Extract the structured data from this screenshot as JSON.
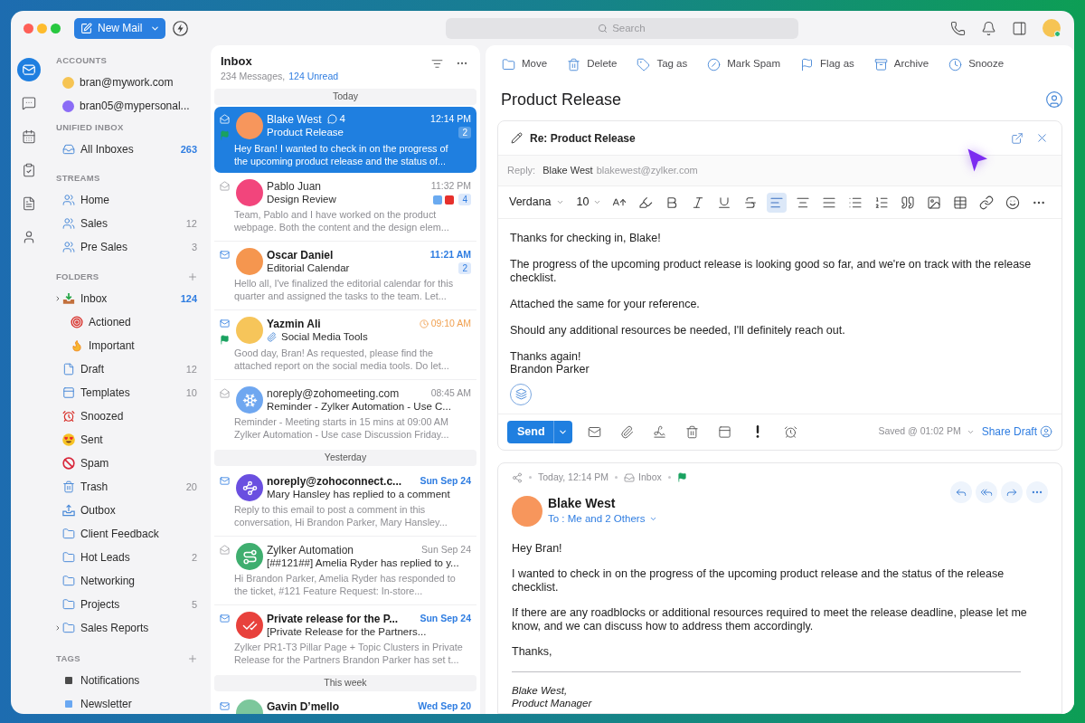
{
  "title_bar": {
    "new_mail": "New Mail",
    "search": {
      "placeholder": "Search"
    }
  },
  "rail": [
    {
      "kind": "mail",
      "selected": true
    },
    {
      "kind": "chat",
      "selected": false
    },
    {
      "kind": "calendar",
      "selected": false
    },
    {
      "kind": "tasks",
      "selected": false
    },
    {
      "kind": "notes",
      "selected": false
    },
    {
      "kind": "contacts",
      "selected": false
    }
  ],
  "sidebar": {
    "sections": [
      {
        "heading": "ACCOUNTS",
        "addable": false,
        "items": [
          {
            "kind": "account",
            "label": "bran@mywork.com",
            "color": "#f6c453"
          },
          {
            "kind": "account",
            "label": "bran05@mypersonal...",
            "color": "#8b6cf6"
          }
        ]
      },
      {
        "heading": "UNIFIED INBOX",
        "addable": false,
        "items": [
          {
            "kind": "unified",
            "label": "All Inboxes",
            "count": "263",
            "count_unread": true
          }
        ]
      },
      {
        "heading": "STREAMS",
        "addable": false,
        "items": [
          {
            "kind": "stream",
            "label": "Home"
          },
          {
            "kind": "stream",
            "label": "Sales",
            "count": "12",
            "count_unread": false
          },
          {
            "kind": "stream",
            "label": "Pre Sales",
            "count": "3",
            "count_unread": false
          }
        ]
      },
      {
        "heading": "FOLDERS",
        "addable": true,
        "items": [
          {
            "kind": "inbox",
            "label": "Inbox",
            "count": "124",
            "count_unread": true,
            "expanded": false,
            "children": [
              {
                "kind": "actioned",
                "label": "Actioned"
              },
              {
                "kind": "important",
                "label": "Important"
              }
            ]
          },
          {
            "kind": "draft",
            "label": "Draft",
            "count": "12",
            "count_unread": false
          },
          {
            "kind": "templates",
            "label": "Templates",
            "count": "10",
            "count_unread": false
          },
          {
            "kind": "snoozed",
            "label": "Snoozed"
          },
          {
            "kind": "sent",
            "label": "Sent"
          },
          {
            "kind": "spam",
            "label": "Spam"
          },
          {
            "kind": "trash",
            "label": "Trash",
            "count": "20",
            "count_unread": false
          },
          {
            "kind": "outbox",
            "label": "Outbox"
          },
          {
            "kind": "folder",
            "label": "Client Feedback"
          },
          {
            "kind": "folder",
            "label": "Hot Leads",
            "count": "2",
            "count_unread": false
          },
          {
            "kind": "folder",
            "label": "Networking"
          },
          {
            "kind": "folder",
            "label": "Projects",
            "count": "5",
            "count_unread": false
          },
          {
            "kind": "folder",
            "label": "Sales Reports",
            "expanded": false
          }
        ]
      },
      {
        "heading": "TAGS",
        "addable": true,
        "items": [
          {
            "kind": "tag",
            "label": "Notifications",
            "color": "#4b4b4b"
          },
          {
            "kind": "tag",
            "label": "Newsletter",
            "color": "#6aa8f2"
          }
        ]
      }
    ]
  },
  "mail_list": {
    "title": "Inbox",
    "summary": "234 Messages,",
    "unread": "124 Unread",
    "groups": [
      {
        "label": "Today",
        "messages": [
          {
            "sender": "Blake West",
            "thread_count": "4",
            "subject": "Product Release",
            "time": "12:14 PM",
            "badge": "2",
            "preview": [
              "Hey Bran! I wanted to check in on the progress of",
              "the upcoming product release and the status of..."
            ],
            "selected": true,
            "unread": false,
            "flagged": true,
            "attachment": false,
            "reminder": false,
            "avatar": {
              "kind": "plain",
              "color": "#f7965c"
            }
          },
          {
            "sender": "Pablo Juan",
            "subject": "Design Review",
            "time": "11:32 PM",
            "tags": [
              {
                "color": "#6aaaf0"
              },
              {
                "color": "#e6302c"
              }
            ],
            "badge": "4",
            "preview": [
              "Team, Pablo and I have worked on the product",
              "webpage. Both the content and the design elem..."
            ],
            "selected": false,
            "unread": false,
            "flagged": false,
            "attachment": false,
            "reminder": false,
            "avatar": {
              "kind": "plain",
              "color": "#f2457c"
            }
          },
          {
            "sender": "Oscar Daniel",
            "subject": "Editorial Calendar",
            "time": "11:21 AM",
            "badge": "2",
            "preview": [
              "Hello all, I've finalized the editorial calendar for this",
              "quarter and assigned the tasks to the team. Let..."
            ],
            "selected": false,
            "unread": true,
            "flagged": false,
            "attachment": false,
            "reminder": false,
            "avatar": {
              "kind": "plain",
              "color": "#f5964f"
            }
          },
          {
            "sender": "Yazmin Ali",
            "subject": "Social Media Tools",
            "time": "09:10 AM",
            "preview": [
              "Good day, Bran! As requested, please find the",
              "attached report on the social media tools. Do let..."
            ],
            "selected": false,
            "unread": true,
            "flagged": true,
            "attachment": true,
            "reminder": true,
            "avatar": {
              "kind": "plain",
              "color": "#f6c55a"
            }
          },
          {
            "sender": "noreply@zohomeeting.com",
            "subject": "Reminder - Zylker Automation - Use C...",
            "time": "08:45 AM",
            "preview": [
              "Reminder - Meeting starts in 15 mins at 09:00 AM",
              "Zylker Automation - Use case Discussion Friday..."
            ],
            "selected": false,
            "unread": false,
            "flagged": false,
            "attachment": false,
            "reminder": false,
            "avatar": {
              "kind": "meeting",
              "color": "#6fa7f0"
            }
          }
        ]
      },
      {
        "label": "Yesterday",
        "messages": [
          {
            "sender": "noreply@zohoconnect.c...",
            "subject": "Mary Hansley has replied to a comment",
            "time": "Sun Sep 24",
            "preview": [
              "Reply to this email to post a comment in this",
              "conversation, Hi Brandon Parker, Mary Hansley..."
            ],
            "selected": false,
            "unread": true,
            "flagged": false,
            "attachment": false,
            "reminder": false,
            "avatar": {
              "kind": "connect",
              "color": "#6a4fe0"
            }
          },
          {
            "sender": "Zylker Automation",
            "subject": "[##121##] Amelia Ryder has replied to y...",
            "time": "Sun Sep 24",
            "preview": [
              "Hi Brandon Parker, Amelia Ryder has responded to",
              "the ticket, #121 Feature Request: In-store..."
            ],
            "selected": false,
            "unread": false,
            "flagged": false,
            "attachment": false,
            "reminder": false,
            "avatar": {
              "kind": "desk",
              "color": "#3fae6f"
            }
          },
          {
            "sender": "Private release for the P...",
            "subject": "[Private Release for the Partners...",
            "time": "Sun Sep 24",
            "preview": [
              "Zylker PR1-T3 Pillar Page + Topic Clusters in Private",
              "Release for the Partners Brandon Parker has set t..."
            ],
            "selected": false,
            "unread": true,
            "flagged": false,
            "attachment": false,
            "reminder": false,
            "avatar": {
              "kind": "projects",
              "color": "#e8413c"
            }
          }
        ]
      },
      {
        "label": "This week",
        "messages": [
          {
            "sender": "Gavin D’mello",
            "time": "Wed Sep 20",
            "selected": false,
            "unread": true,
            "flagged": false,
            "attachment": false,
            "reminder": false,
            "avatar": {
              "kind": "plain",
              "color": "#7cc79c"
            }
          }
        ]
      }
    ]
  },
  "reading_pane": {
    "actions": [
      {
        "kind": "move",
        "label": "Move"
      },
      {
        "kind": "delete",
        "label": "Delete"
      },
      {
        "kind": "tag",
        "label": "Tag as"
      },
      {
        "kind": "spam",
        "label": "Mark Spam"
      },
      {
        "kind": "flag",
        "label": "Flag as"
      },
      {
        "kind": "archive",
        "label": "Archive"
      },
      {
        "kind": "snooze",
        "label": "Snooze"
      }
    ],
    "subject": "Product Release",
    "compose": {
      "title": "Re: Product Release",
      "reply_label": "Reply:",
      "recipient_name": "Blake West",
      "recipient_email": "blakewest@zylker.com",
      "font": "Verdana",
      "font_size": "10",
      "format_tools": [
        {
          "kind": "font-size",
          "selected": false
        },
        {
          "kind": "highlight",
          "selected": false
        },
        {
          "kind": "bold",
          "selected": false
        },
        {
          "kind": "italic",
          "selected": false
        },
        {
          "kind": "underline",
          "selected": false
        },
        {
          "kind": "strikethrough",
          "selected": false
        },
        {
          "kind": "align-left",
          "selected": true
        },
        {
          "kind": "align-center",
          "selected": false
        },
        {
          "kind": "align-justify",
          "selected": false
        },
        {
          "kind": "bullet-list",
          "selected": false
        },
        {
          "kind": "numbered-list",
          "selected": false
        },
        {
          "kind": "quote",
          "selected": false
        },
        {
          "kind": "image",
          "selected": false
        },
        {
          "kind": "table",
          "selected": false
        },
        {
          "kind": "link",
          "selected": false
        },
        {
          "kind": "emoji",
          "selected": false
        },
        {
          "kind": "more",
          "selected": false
        }
      ],
      "body": [
        "Thanks for checking in, Blake!",
        "The progress of the upcoming product release is looking good so far, and we're on track with the release checklist.",
        "Attached the same for your reference.",
        "Should any additional resources be needed, I'll definitely reach out."
      ],
      "sign_off": [
        "Thanks again!",
        "Brandon Parker"
      ],
      "send": "Send",
      "bottom_tools": [
        {
          "kind": "schedule"
        },
        {
          "kind": "attach"
        },
        {
          "kind": "signature"
        },
        {
          "kind": "discard"
        },
        {
          "kind": "template"
        },
        {
          "kind": "priority"
        },
        {
          "kind": "reminder"
        }
      ],
      "saved": "Saved @ 01:02 PM",
      "share": "Share Draft"
    },
    "message": {
      "time": "Today, 12:14 PM",
      "folder": "Inbox",
      "flagged": true,
      "sender": "Blake West",
      "to": "To : Me and 2 Others",
      "avatar": {
        "color": "#f7965c"
      },
      "body": [
        "Hey Bran!",
        "I wanted to check in on the progress of the upcoming product release and the status of the release checklist.",
        "If there are any roadblocks or additional resources required to meet the release deadline, please let me know, and we can discuss how to address them accordingly.",
        "Thanks,"
      ],
      "signature": [
        "Blake West,",
        "Product Manager"
      ]
    }
  }
}
